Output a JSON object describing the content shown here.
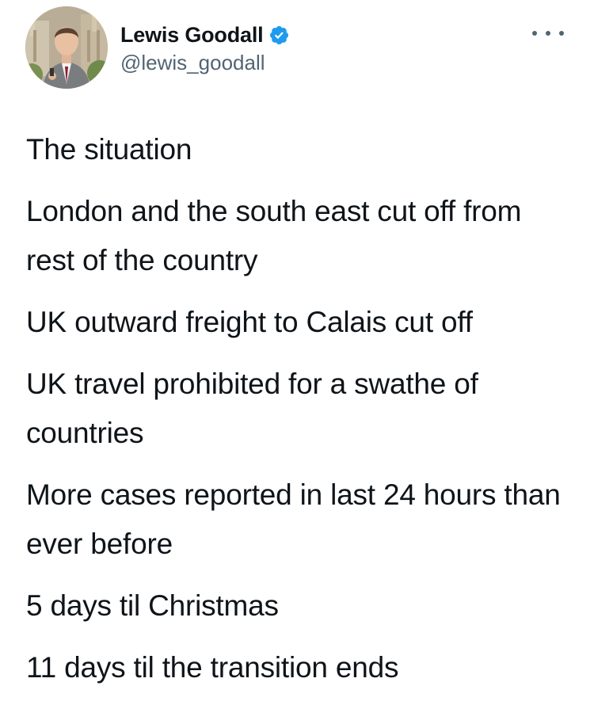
{
  "author": {
    "display_name": "Lewis Goodall",
    "handle": "@lewis_goodall",
    "verified": true,
    "avatar_icon": "profile-photo",
    "verified_icon": "verified-badge-icon",
    "verified_color": "#1d9bf0"
  },
  "menu": {
    "icon": "more-options-icon"
  },
  "tweet": {
    "paragraphs": [
      "The situation",
      "London and the south east cut off from rest of the country",
      "UK outward freight to Calais cut off",
      "UK travel prohibited for a swathe of countries",
      "More cases reported in last 24 hours than ever before",
      "5 days til Christmas",
      "11 days til the transition ends"
    ]
  },
  "colors": {
    "text": "#0f1419",
    "secondary_text": "#536471",
    "background": "#ffffff"
  }
}
